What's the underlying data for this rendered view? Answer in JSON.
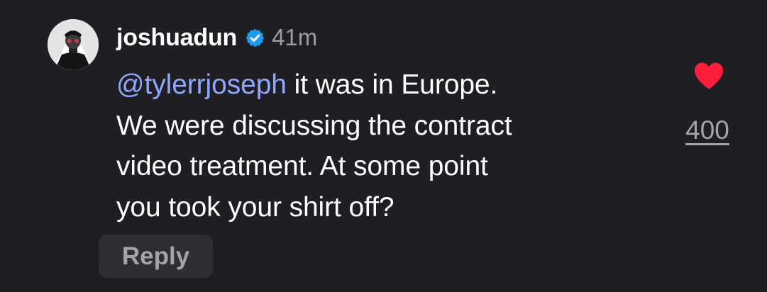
{
  "comment": {
    "username": "joshuadun",
    "verified": true,
    "timestamp": "41m",
    "mention": "@tylerrjoseph",
    "body_lines": [
      " it was in Europe.",
      "We were discussing the contract",
      "video treatment. At some point",
      "you took your shirt off?"
    ],
    "reply_label": "Reply",
    "like_count": "400",
    "liked": true,
    "icons": {
      "avatar": "avatar",
      "verified": "verified-badge-icon",
      "like": "heart-icon"
    },
    "colors": {
      "background": "#1f1f23",
      "mention": "#8fa7ff",
      "verified_badge": "#1d9bf0",
      "heart": "#ff1e3c",
      "muted_text": "#a3a3a9"
    }
  }
}
